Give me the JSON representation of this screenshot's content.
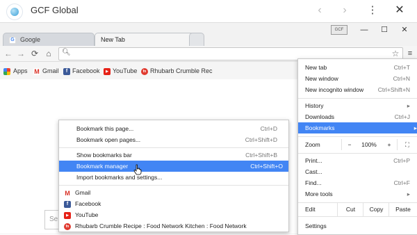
{
  "app": {
    "title": "GCF Global"
  },
  "tabs": [
    {
      "label": "Google"
    },
    {
      "label": "New Tab"
    }
  ],
  "window_controls": {
    "profile_badge": "GCF",
    "minimize": "—",
    "maximize": "☐",
    "close": "✕"
  },
  "bookmarks_bar": {
    "items": [
      {
        "label": "Apps",
        "icon": "apps-icon"
      },
      {
        "label": "Gmail",
        "icon": "gmail-icon"
      },
      {
        "label": "Facebook",
        "icon": "facebook-icon"
      },
      {
        "label": "YouTube",
        "icon": "youtube-icon"
      },
      {
        "label": "Rhubarb Crumble Rec",
        "icon": "food-network-icon"
      }
    ]
  },
  "chrome_menu": {
    "items": [
      {
        "label": "New tab",
        "shortcut": "Ctrl+T"
      },
      {
        "label": "New window",
        "shortcut": "Ctrl+N"
      },
      {
        "label": "New incognito window",
        "shortcut": "Ctrl+Shift+N"
      },
      {
        "label": "History",
        "shortcut": "▸"
      },
      {
        "label": "Downloads",
        "shortcut": "Ctrl+J"
      },
      {
        "label": "Bookmarks",
        "shortcut": "▸"
      },
      {
        "label": "Zoom",
        "minus": "−",
        "value": "100%",
        "plus": "+",
        "fullscreen": "⛶"
      },
      {
        "label": "Print...",
        "shortcut": "Ctrl+P"
      },
      {
        "label": "Cast...",
        "shortcut": ""
      },
      {
        "label": "Find...",
        "shortcut": "Ctrl+F"
      },
      {
        "label": "More tools",
        "shortcut": "▸"
      },
      {
        "label": "Edit",
        "cut": "Cut",
        "copy": "Copy",
        "paste": "Paste"
      },
      {
        "label": "Settings",
        "shortcut": ""
      }
    ]
  },
  "bookmarks_submenu": {
    "items": [
      {
        "label": "Bookmark this page...",
        "shortcut": "Ctrl+D"
      },
      {
        "label": "Bookmark open pages...",
        "shortcut": "Ctrl+Shift+D"
      },
      {
        "label": "Show bookmarks bar",
        "shortcut": "Ctrl+Shift+B"
      },
      {
        "label": "Bookmark manager",
        "shortcut": "Ctrl+Shift+O"
      },
      {
        "label": "Import bookmarks and settings...",
        "shortcut": ""
      },
      {
        "label": "Gmail",
        "icon": "gmail-icon"
      },
      {
        "label": "Facebook",
        "icon": "facebook-icon"
      },
      {
        "label": "YouTube",
        "icon": "youtube-icon"
      },
      {
        "label": "Rhubarb Crumble Recipe : Food Network Kitchen : Food Network",
        "icon": "food-network-icon"
      }
    ]
  },
  "page": {
    "search_placeholder": "Se"
  },
  "colors": {
    "highlight": "#4285f4"
  }
}
